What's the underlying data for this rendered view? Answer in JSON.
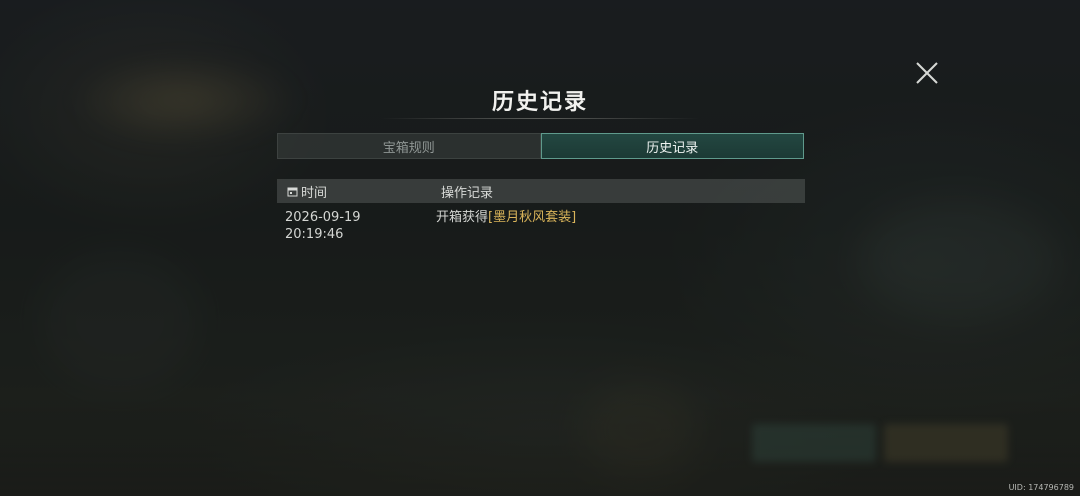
{
  "dialog": {
    "title": "历史记录",
    "close_icon": "close-icon"
  },
  "tabs": [
    {
      "label": "宝箱规则",
      "active": false
    },
    {
      "label": "历史记录",
      "active": true
    }
  ],
  "table": {
    "headers": {
      "time": "时间",
      "operation": "操作记录",
      "time_icon": "calendar-icon"
    },
    "rows": [
      {
        "date": "2026-09-19",
        "time": "20:19:46",
        "action": "开箱获得",
        "item": "[墨月秋风套装]"
      }
    ]
  },
  "footer": {
    "uid": "UID: 174796789"
  },
  "colors": {
    "accent_teal": "#5f9a8c",
    "item_gold": "#d9b45a",
    "text_light": "#f2f2ef"
  }
}
